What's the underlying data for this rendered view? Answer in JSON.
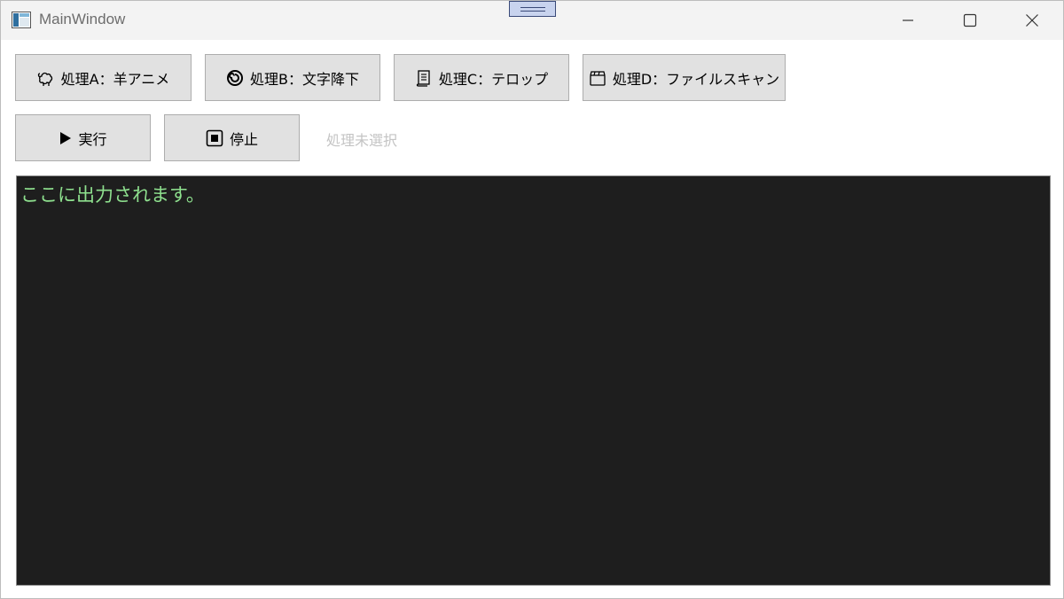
{
  "window": {
    "title": "MainWindow"
  },
  "process_buttons": [
    {
      "label": "処理A：羊アニメ",
      "icon": "sheep-icon"
    },
    {
      "label": "処理B：文字降下",
      "icon": "spiral-icon"
    },
    {
      "label": "処理C：テロップ",
      "icon": "scroll-icon"
    },
    {
      "label": "処理D：ファイルスキャン",
      "icon": "clapperboard-icon"
    }
  ],
  "controls": {
    "run_label": "実行",
    "stop_label": "停止",
    "status_text": "処理未選択"
  },
  "output": {
    "text": "ここに出力されます。"
  },
  "colors": {
    "console_bg": "#1e1e1e",
    "console_text": "#8ee08e",
    "button_bg": "#e1e1e1"
  }
}
